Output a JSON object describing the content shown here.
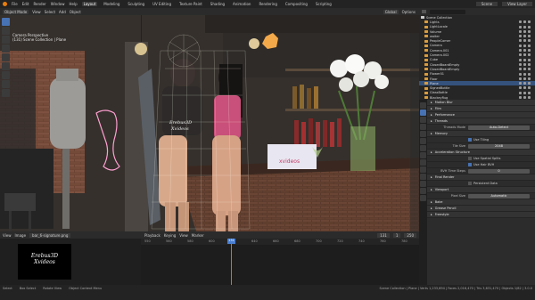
{
  "menu": {
    "items": [
      "File",
      "Edit",
      "Render",
      "Window",
      "Help"
    ],
    "workspaces": [
      "Layout",
      "Modeling",
      "Sculpting",
      "UV Editing",
      "Texture Paint",
      "Shading",
      "Animation",
      "Rendering",
      "Compositing",
      "Scripting"
    ],
    "active_workspace": "Layout",
    "scene": "Scene",
    "view_layer": "View Layer"
  },
  "viewport": {
    "mode": "Object Mode",
    "header_items": [
      "View",
      "Select",
      "Add",
      "Object"
    ],
    "transform": "Global",
    "options": "Options",
    "info_line1": "Camera Perspective",
    "info_line2": "(131) Scene Collection | Plane"
  },
  "outliner": {
    "title": "Scene Collection",
    "items": [
      {
        "label": "Lights"
      },
      {
        "label": "LightLocale"
      },
      {
        "label": "Volume"
      },
      {
        "label": "waiter"
      },
      {
        "label": "PeopleComer"
      },
      {
        "label": "Camera"
      },
      {
        "label": "Camera.001"
      },
      {
        "label": "Camera.002"
      },
      {
        "label": "Cube"
      },
      {
        "label": "ClosedBoardEmpty"
      },
      {
        "label": "ClosedBoardEmpty"
      },
      {
        "label": "Flower01"
      },
      {
        "label": "Floor"
      },
      {
        "label": "Plane",
        "selected": true
      },
      {
        "label": "SignedBottle"
      },
      {
        "label": "GlassBottle"
      },
      {
        "label": "BlackeyRug"
      },
      {
        "label": "blackLeatherEmpty"
      },
      {
        "label": "blackLeatherEmpty"
      }
    ]
  },
  "properties": {
    "rows": [
      {
        "type": "section",
        "label": "Motion Blur"
      },
      {
        "type": "section",
        "label": "Film"
      },
      {
        "type": "section",
        "label": "Performance"
      },
      {
        "type": "section",
        "label": "Threads"
      },
      {
        "type": "field",
        "label": "Threads Mode",
        "value": "Auto-Detect"
      },
      {
        "type": "section",
        "label": "Memory"
      },
      {
        "type": "check",
        "label": "Use Tiling",
        "on": true
      },
      {
        "type": "field",
        "label": "Tile Size",
        "value": "2048"
      },
      {
        "type": "section",
        "label": "Acceleration Structure"
      },
      {
        "type": "check",
        "label": "Use Spatial Splits",
        "on": false
      },
      {
        "type": "check",
        "label": "Use Hair BVH",
        "on": true
      },
      {
        "type": "field",
        "label": "BVH Time Steps",
        "value": "0"
      },
      {
        "type": "section",
        "label": "Final Render"
      },
      {
        "type": "check",
        "label": "Persistent Data",
        "on": false
      },
      {
        "type": "section",
        "label": "Viewport"
      },
      {
        "type": "field",
        "label": "Pixel Size",
        "value": "Automatic"
      },
      {
        "type": "section",
        "label": "Bake"
      },
      {
        "type": "section",
        "label": "Grease Pencil"
      },
      {
        "type": "section",
        "label": "Freestyle"
      }
    ]
  },
  "filebrowser": {
    "header_items": [
      "View",
      "Image"
    ],
    "filename": "bar_6-signature.png",
    "thumb_line1": "Erebus3D",
    "thumb_line2": "Xvideos"
  },
  "timeline": {
    "header_items": [
      "Playback",
      "Keying",
      "View",
      "Marker"
    ],
    "current_frame": 131,
    "start": 1,
    "end": 250,
    "ticks": [
      "550",
      "560",
      "580",
      "600",
      "620",
      "640",
      "660",
      "680",
      "700",
      "720",
      "740",
      "760",
      "780"
    ]
  },
  "statusbar": {
    "left": [
      "Select",
      "Box Select",
      "Rotate View",
      "Object Context Menu"
    ],
    "right": "Scene Collection | Plane | Verts 1,233,694 | Faces 2,016,470 | Tris 3,631,470 | Objects 1/82 | 3.0.0"
  },
  "viewport_text": {
    "sign": "xvideos",
    "shirt_line1": "Erebus3D",
    "shirt_line2": "Xvideos"
  },
  "colors": {
    "accent": "#4772b3",
    "selected_row": "#35527d",
    "playhead": "#4a90e2"
  }
}
